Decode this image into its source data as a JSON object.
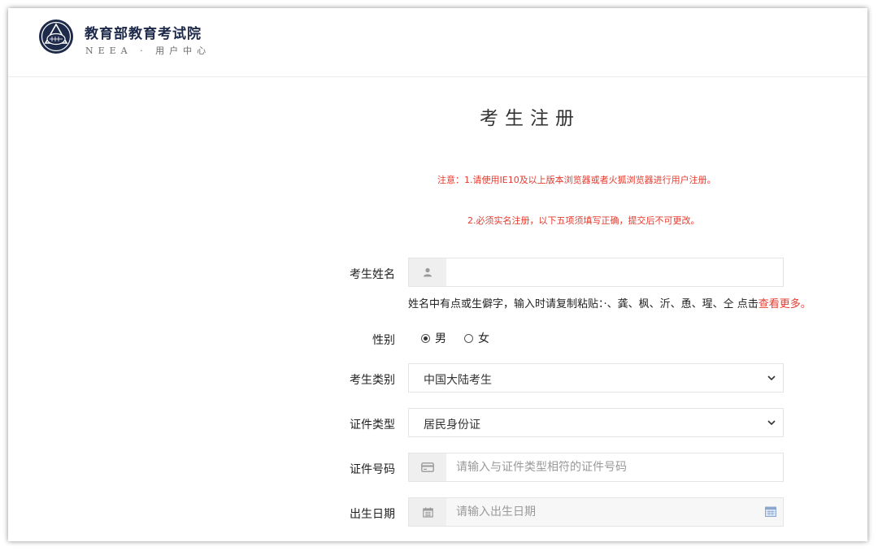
{
  "header": {
    "title": "教育部教育考试院",
    "subtitle": "NEEA · 用户中心"
  },
  "page": {
    "title": "考生注册"
  },
  "notices": {
    "line1": "注意：1.请使用IE10及以上版本浏览器或者火狐浏览器进行用户注册。",
    "line2": "2.必须实名注册，以下五项须填写正确，提交后不可更改。"
  },
  "form": {
    "name": {
      "label": "考生姓名",
      "value": "",
      "icon": "user-icon",
      "hint": "姓名中有点或生僻字，输入时请复制粘贴：·、龚、枫、沂、恿、瑆、仝 点击",
      "hint_link": "查看更多。"
    },
    "gender": {
      "label": "性别",
      "options": [
        "男",
        "女"
      ],
      "selected": "男"
    },
    "candidate_type": {
      "label": "考生类别",
      "value": "中国大陆考生"
    },
    "id_type": {
      "label": "证件类型",
      "value": "居民身份证"
    },
    "id_number": {
      "label": "证件号码",
      "placeholder": "请输入与证件类型相符的证件号码",
      "icon": "id-card-icon"
    },
    "birth_date": {
      "label": "出生日期",
      "placeholder": "请输入出生日期",
      "icon": "calendar-icon"
    }
  },
  "colors": {
    "accent_red": "#e63a2e",
    "brand_navy": "#1e2a4a",
    "addon_bg": "#efefef"
  }
}
